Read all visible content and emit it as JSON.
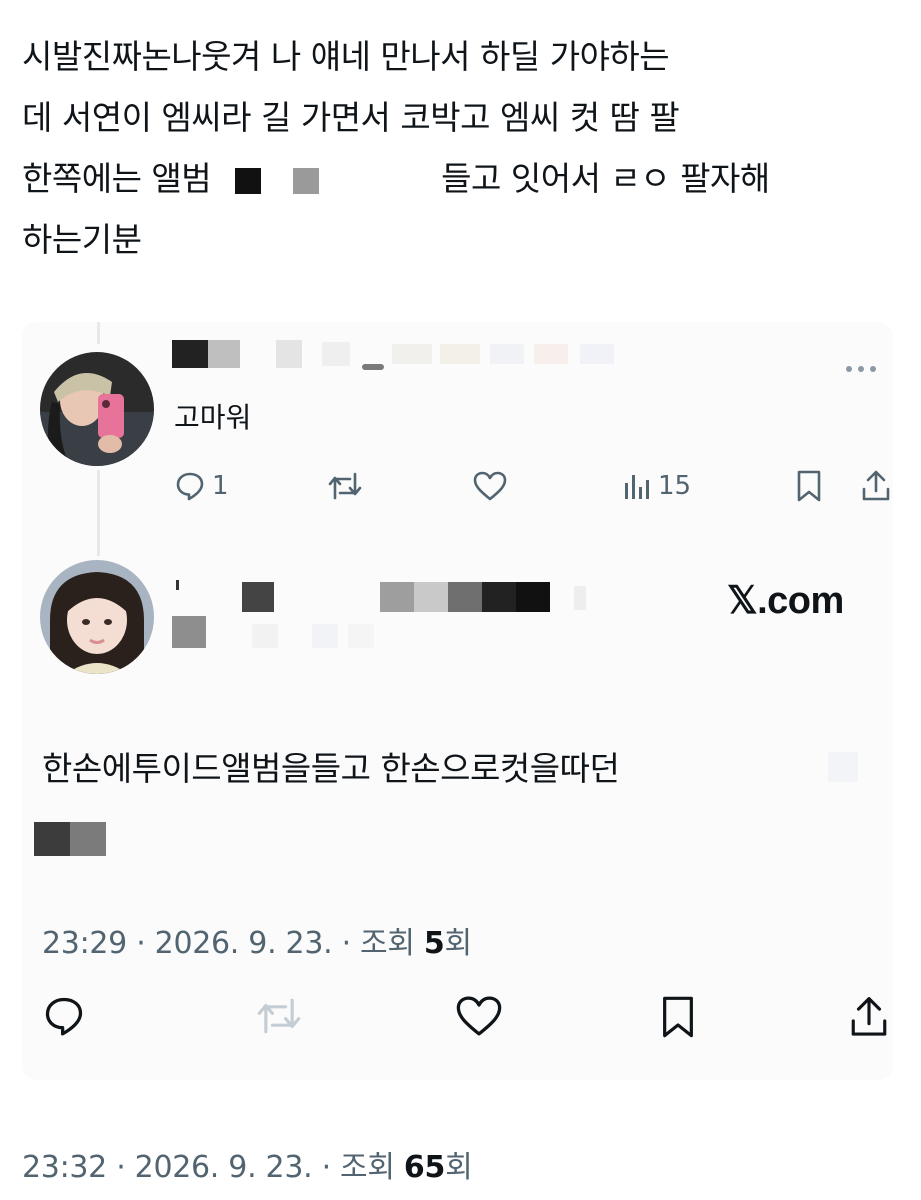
{
  "post": {
    "line1": "시발진짜논나웃겨 나 얘네 만나서 하딜 가야하는",
    "line2": "데 서연이 엠씨라 길 가면서 코박고 엠씨 컷 땀 팔",
    "line3a": "한쪽에는 앨범",
    "line3b": "들고 잇어서 ㄹㅇ 팔자해",
    "line4": "하는기분"
  },
  "quoted": {
    "reply": {
      "text": "고마워",
      "reply_count": "1",
      "view_count": "15"
    },
    "tweet": {
      "source": "𝕏.com",
      "body": "한손에투이드앨범을들고 한손으로컷을따던",
      "timestamp": "23:29 · 2026. 9. 23. · 조회 ",
      "views": "5",
      "views_suffix": "회"
    }
  },
  "footer": {
    "timestamp": "23:32 · 2026. 9. 23. · 조회 ",
    "views": "65",
    "views_suffix": "회"
  },
  "colors": {
    "text": "#0f1419",
    "muted": "#536471",
    "card_bg": "#fbfbfb",
    "thread_line": "#e6e8ea"
  },
  "icons": [
    "reply-icon",
    "retweet-icon",
    "like-icon",
    "views-icon",
    "bookmark-icon",
    "share-icon",
    "more-icon"
  ]
}
